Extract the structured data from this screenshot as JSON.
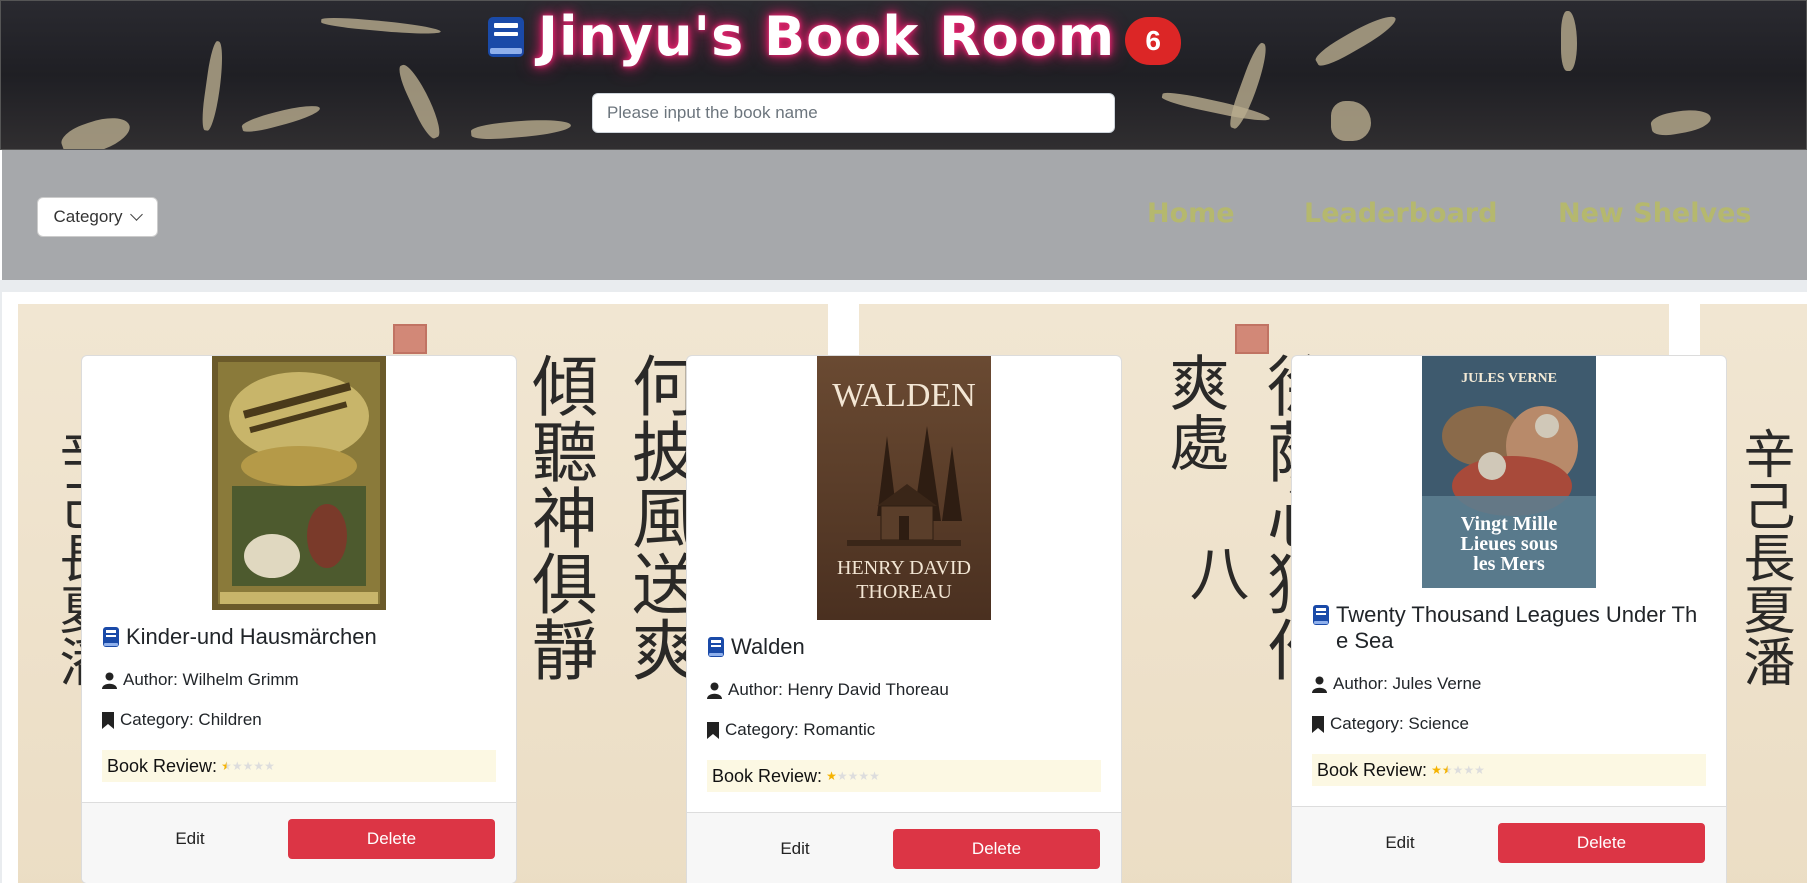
{
  "header": {
    "title": "Jinyu's Book Room",
    "book_count": "6",
    "search_placeholder": "Please input the book name"
  },
  "nav": {
    "category_label": "Category",
    "links": [
      "Home",
      "Leaderboard",
      "New Shelves"
    ]
  },
  "books": [
    {
      "title": "Kinder-und Hausmärchen",
      "author": "Author: Wilhelm Grimm",
      "category": "Category: Children",
      "review_label": "Book Review:",
      "rating": 0.5,
      "edit_label": "Edit",
      "delete_label": "Delete"
    },
    {
      "title": "Walden",
      "author": "Author: Henry David Thoreau",
      "category": "Category: Romantic",
      "review_label": "Book Review:",
      "rating": 1,
      "edit_label": "Edit",
      "delete_label": "Delete",
      "cover_text": [
        "WALDEN",
        "HENRY DAVID",
        "THOREAU"
      ]
    },
    {
      "title": "Twenty Thousand Leagues Under The Sea",
      "author": "Author: Jules Verne",
      "category": "Category: Science",
      "review_label": "Book Review:",
      "rating": 1.5,
      "edit_label": "Edit",
      "delete_label": "Delete",
      "cover_text": [
        "JULES VERNE",
        "Vingt Mille",
        "Lieues sous",
        "les Mers"
      ]
    }
  ],
  "colors": {
    "accent_title_glow": "#e8236f",
    "badge": "#dc2626",
    "nav_bg": "#a6a8ab",
    "nav_link": "#b5b86e",
    "delete": "#dc3545",
    "review_bg": "#fcf8e3",
    "star": "#f5b301"
  },
  "icons": [
    "book-icon",
    "user-icon",
    "bookmark-icon",
    "chevron-down-icon",
    "star-icon"
  ]
}
